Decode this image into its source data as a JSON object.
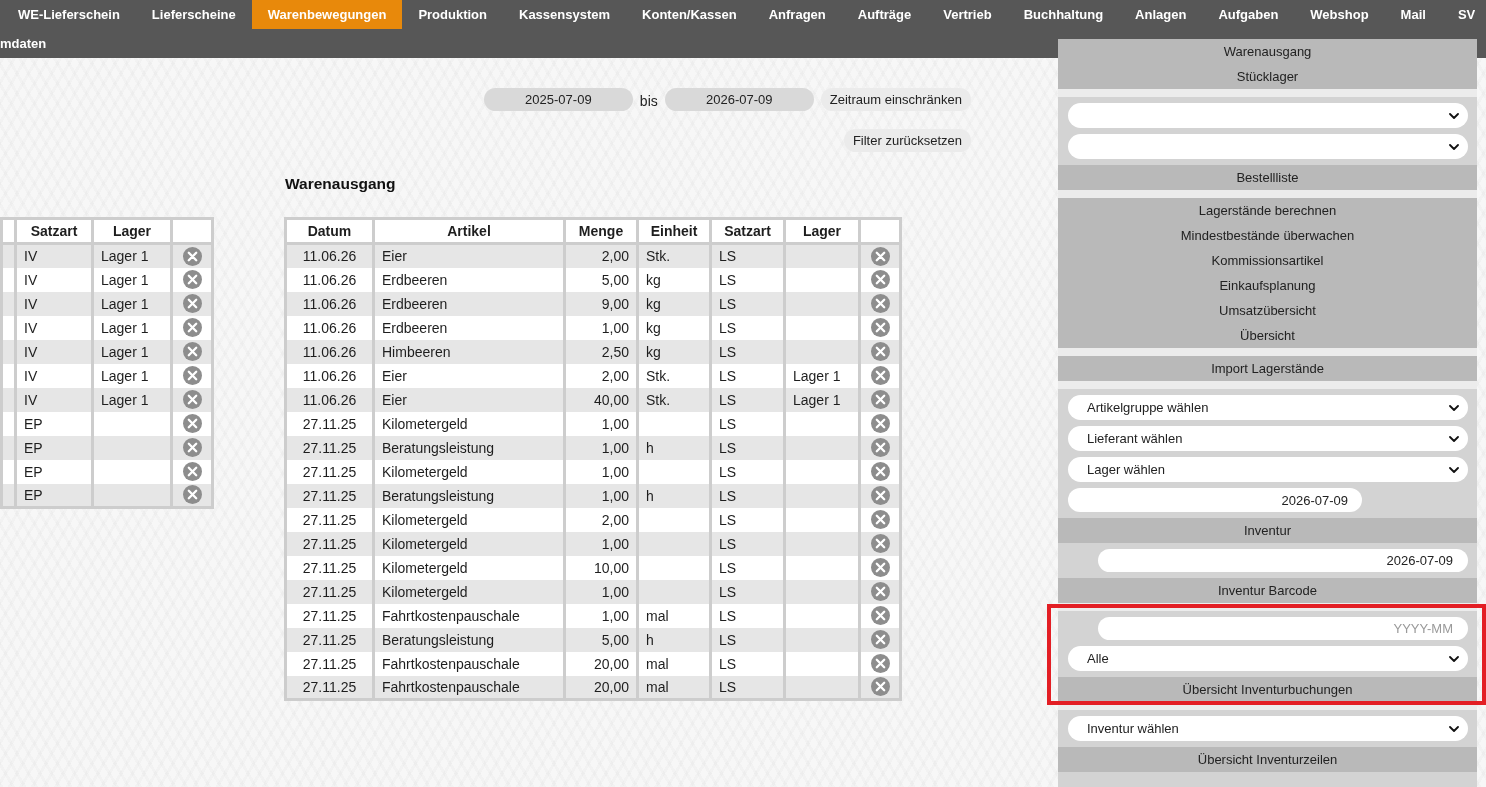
{
  "nav": {
    "rows": [
      {
        "tabs": [
          {
            "label": "WE-Lieferschein",
            "selected": false
          },
          {
            "label": "Lieferscheine",
            "selected": false
          },
          {
            "label": "Warenbewegungen",
            "selected": true
          },
          {
            "label": "Produktion",
            "selected": false
          },
          {
            "label": "Kassensystem",
            "selected": false
          },
          {
            "label": "Konten/Kassen",
            "selected": false
          },
          {
            "label": "Anfragen",
            "selected": false
          },
          {
            "label": "Aufträge",
            "selected": false
          },
          {
            "label": "Vertrieb",
            "selected": false
          },
          {
            "label": "Buchhaltung",
            "selected": false
          },
          {
            "label": "Anlagen",
            "selected": false
          },
          {
            "label": "Aufgaben",
            "selected": false
          },
          {
            "label": "Webshop",
            "selected": false
          },
          {
            "label": "Mail",
            "selected": false
          },
          {
            "label": "SV",
            "selected": false
          }
        ]
      },
      {
        "tabs": [
          {
            "label": "mdaten",
            "selected": false
          }
        ]
      }
    ]
  },
  "filter": {
    "from": "2025-07-09",
    "separator": "bis",
    "to": "2026-07-09",
    "apply_button": "Zeitraum einschränken",
    "reset_button": "Filter zurücksetzen"
  },
  "left_table": {
    "columns": [
      "Satzart",
      "Lager"
    ],
    "rows": [
      {
        "satzart": "IV",
        "lager": "Lager 1"
      },
      {
        "satzart": "IV",
        "lager": "Lager 1"
      },
      {
        "satzart": "IV",
        "lager": "Lager 1"
      },
      {
        "satzart": "IV",
        "lager": "Lager 1"
      },
      {
        "satzart": "IV",
        "lager": "Lager 1"
      },
      {
        "satzart": "IV",
        "lager": "Lager 1"
      },
      {
        "satzart": "IV",
        "lager": "Lager 1"
      },
      {
        "satzart": "EP"
      },
      {
        "satzart": "EP"
      },
      {
        "satzart": "EP"
      },
      {
        "satzart": "EP"
      }
    ]
  },
  "warenausgang": {
    "title": "Warenausgang",
    "columns": [
      "Datum",
      "Artikel",
      "Menge",
      "Einheit",
      "Satzart",
      "Lager"
    ],
    "rows": [
      {
        "datum": "11.06.26",
        "artikel": "Eier",
        "menge": "2,00",
        "einheit": "Stk.",
        "satzart": "LS"
      },
      {
        "datum": "11.06.26",
        "artikel": "Erdbeeren",
        "menge": "5,00",
        "einheit": "kg",
        "satzart": "LS"
      },
      {
        "datum": "11.06.26",
        "artikel": "Erdbeeren",
        "menge": "9,00",
        "einheit": "kg",
        "satzart": "LS"
      },
      {
        "datum": "11.06.26",
        "artikel": "Erdbeeren",
        "menge": "1,00",
        "einheit": "kg",
        "satzart": "LS"
      },
      {
        "datum": "11.06.26",
        "artikel": "Himbeeren",
        "menge": "2,50",
        "einheit": "kg",
        "satzart": "LS"
      },
      {
        "datum": "11.06.26",
        "artikel": "Eier",
        "menge": "2,00",
        "einheit": "Stk.",
        "satzart": "LS",
        "lager": "Lager 1"
      },
      {
        "datum": "11.06.26",
        "artikel": "Eier",
        "menge": "40,00",
        "einheit": "Stk.",
        "satzart": "LS",
        "lager": "Lager 1"
      },
      {
        "datum": "27.11.25",
        "artikel": "Kilometergeld",
        "menge": "1,00",
        "satzart": "LS"
      },
      {
        "datum": "27.11.25",
        "artikel": "Beratungsleistung",
        "menge": "1,00",
        "einheit": "h",
        "satzart": "LS"
      },
      {
        "datum": "27.11.25",
        "artikel": "Kilometergeld",
        "menge": "1,00",
        "satzart": "LS"
      },
      {
        "datum": "27.11.25",
        "artikel": "Beratungsleistung",
        "menge": "1,00",
        "einheit": "h",
        "satzart": "LS"
      },
      {
        "datum": "27.11.25",
        "artikel": "Kilometergeld",
        "menge": "2,00",
        "satzart": "LS"
      },
      {
        "datum": "27.11.25",
        "artikel": "Kilometergeld",
        "menge": "1,00",
        "satzart": "LS"
      },
      {
        "datum": "27.11.25",
        "artikel": "Kilometergeld",
        "menge": "10,00",
        "satzart": "LS"
      },
      {
        "datum": "27.11.25",
        "artikel": "Kilometergeld",
        "menge": "1,00",
        "satzart": "LS"
      },
      {
        "datum": "27.11.25",
        "artikel": "Fahrtkostenpauschale",
        "menge": "1,00",
        "einheit": "mal",
        "satzart": "LS"
      },
      {
        "datum": "27.11.25",
        "artikel": "Beratungsleistung",
        "menge": "5,00",
        "einheit": "h",
        "satzart": "LS"
      },
      {
        "datum": "27.11.25",
        "artikel": "Fahrtkostenpauschale",
        "menge": "20,00",
        "einheit": "mal",
        "satzart": "LS"
      },
      {
        "datum": "27.11.25",
        "artikel": "Fahrtkostenpauschale",
        "menge": "20,00",
        "einheit": "mal",
        "satzart": "LS"
      }
    ]
  },
  "sidebar": {
    "groups": [
      {
        "parts": [
          {
            "kind": "link",
            "label": "Warenausgang"
          },
          {
            "kind": "link",
            "label": "Stücklager"
          }
        ]
      },
      {
        "parts": [
          {
            "kind": "select"
          },
          {
            "kind": "select"
          },
          {
            "kind": "button",
            "label": "Bestellliste"
          }
        ]
      },
      {
        "parts": [
          {
            "kind": "link",
            "label": "Lagerstände berechnen"
          },
          {
            "kind": "link",
            "label": "Mindestbestände überwachen"
          },
          {
            "kind": "link",
            "label": "Kommissionsartikel"
          },
          {
            "kind": "link",
            "label": "Einkaufsplanung"
          },
          {
            "kind": "link",
            "label": "Umsatzübersicht"
          },
          {
            "kind": "link",
            "label": "Übersicht"
          }
        ]
      },
      {
        "parts": [
          {
            "kind": "button",
            "label": "Import Lagerstände"
          }
        ]
      },
      {
        "parts": [
          {
            "kind": "select",
            "value": "Artikelgruppe wählen"
          },
          {
            "kind": "select",
            "value": "Lieferant wählen"
          },
          {
            "kind": "select",
            "value": "Lager wählen"
          },
          {
            "kind": "date",
            "value": "2026-07-09"
          },
          {
            "kind": "button",
            "label": "Inventur"
          },
          {
            "kind": "input",
            "value": "2026-07-09"
          },
          {
            "kind": "button",
            "label": "Inventur Barcode"
          }
        ]
      },
      {
        "highlighted": true,
        "parts": [
          {
            "kind": "input",
            "placeholder": "YYYY-MM"
          },
          {
            "kind": "select",
            "value": "Alle"
          },
          {
            "kind": "button",
            "label": "Übersicht Inventurbuchungen"
          }
        ]
      },
      {
        "parts": [
          {
            "kind": "select",
            "value": "Inventur wählen"
          },
          {
            "kind": "button",
            "label": "Übersicht Inventurzeilen"
          }
        ]
      }
    ]
  }
}
